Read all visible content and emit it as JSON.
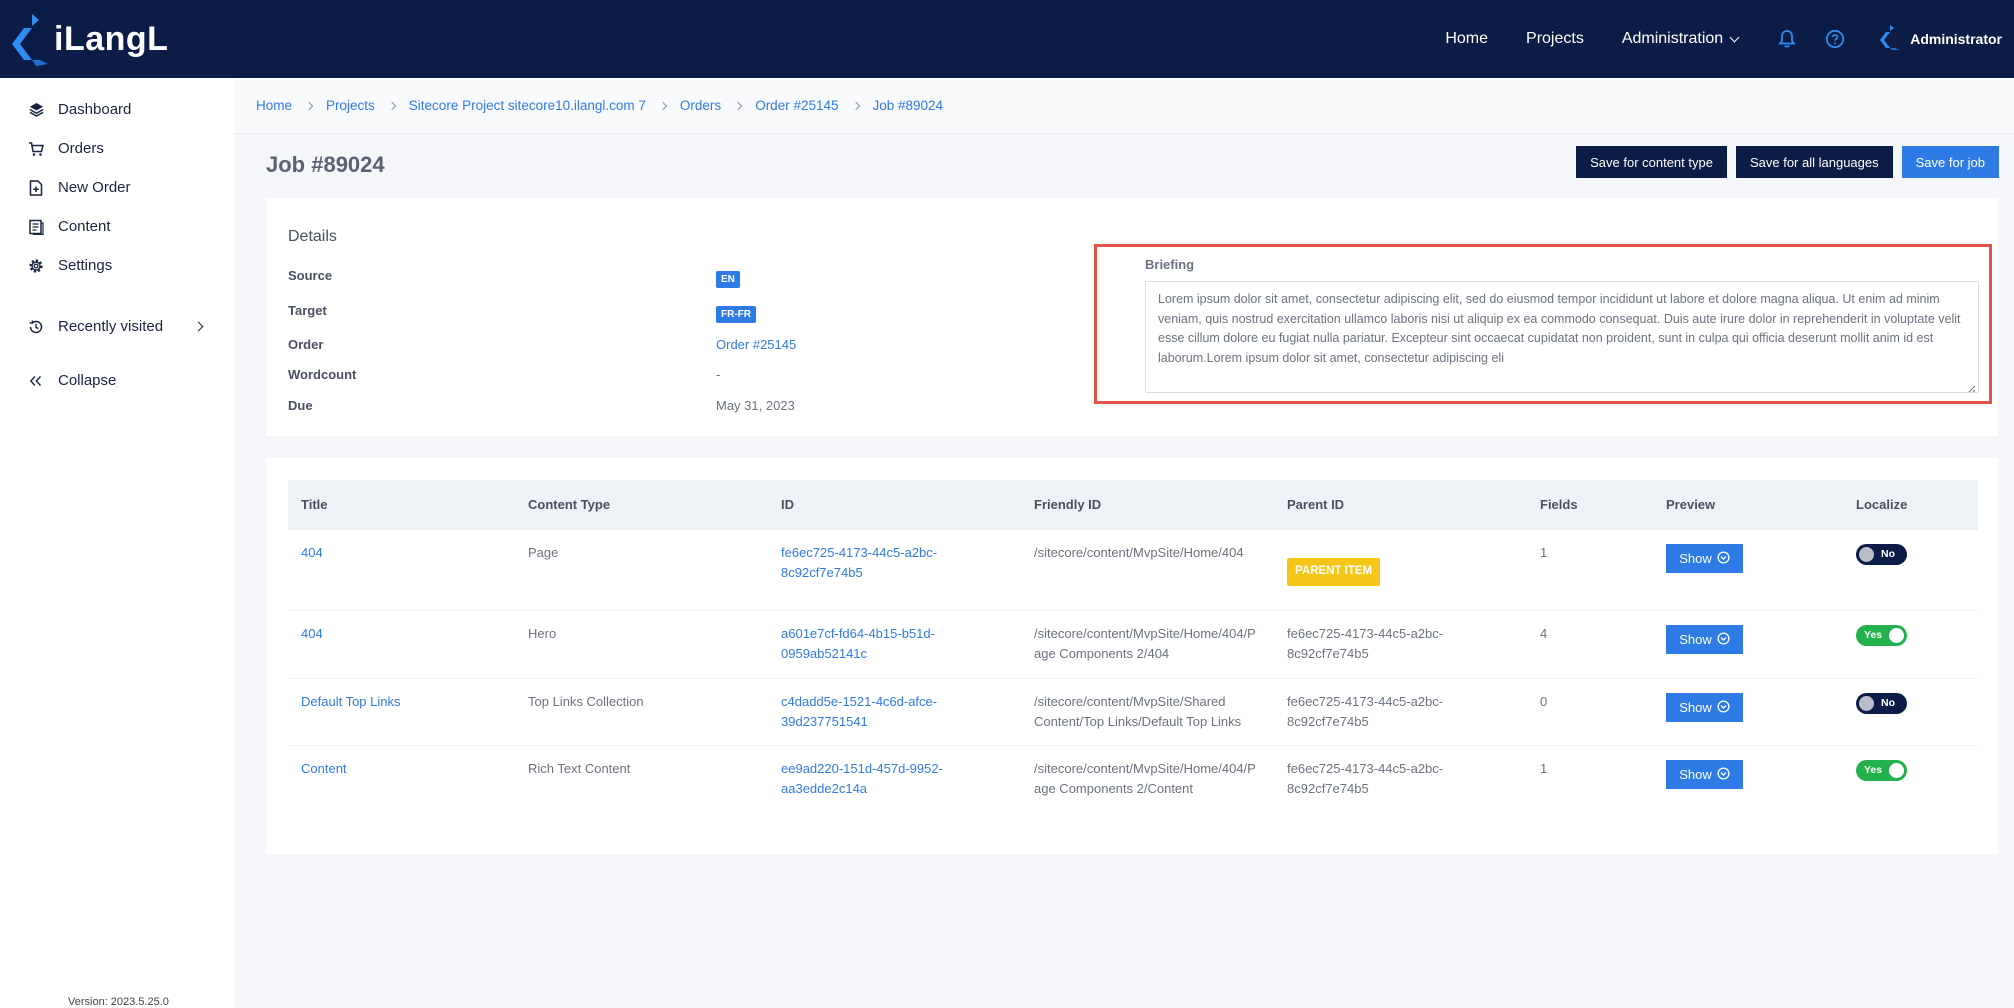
{
  "app": {
    "logo_text": "iLangL"
  },
  "topnav": {
    "home": "Home",
    "projects": "Projects",
    "administration": "Administration",
    "user": "Administrator"
  },
  "sidebar": {
    "items": [
      {
        "label": "Dashboard",
        "icon": "layers-icon"
      },
      {
        "label": "Orders",
        "icon": "cart-icon"
      },
      {
        "label": "New Order",
        "icon": "new-document-icon"
      },
      {
        "label": "Content",
        "icon": "content-icon"
      },
      {
        "label": "Settings",
        "icon": "gear-icon"
      }
    ],
    "recently_visited": "Recently visited",
    "collapse": "Collapse",
    "version": "Version: 2023.5.25.0"
  },
  "breadcrumb": [
    "Home",
    "Projects",
    "Sitecore Project sitecore10.ilangl.com 7",
    "Orders",
    "Order #25145",
    "Job #89024"
  ],
  "page": {
    "title": "Job #89024",
    "actions": {
      "save_content_type": "Save for content type",
      "save_all_languages": "Save for all languages",
      "save_job": "Save for job"
    }
  },
  "details": {
    "title": "Details",
    "source_label": "Source",
    "source_value": "EN",
    "target_label": "Target",
    "target_value": "FR-FR",
    "order_label": "Order",
    "order_value": "Order #25145",
    "wordcount_label": "Wordcount",
    "wordcount_value": "-",
    "due_label": "Due",
    "due_value": "May 31, 2023"
  },
  "briefing": {
    "label": "Briefing",
    "text": "Lorem ipsum dolor sit amet, consectetur adipiscing elit, sed do eiusmod tempor incididunt ut labore et dolore magna aliqua. Ut enim ad minim veniam, quis nostrud exercitation ullamco laboris nisi ut aliquip ex ea commodo consequat. Duis aute irure dolor in reprehenderit in voluptate velit esse cillum dolore eu fugiat nulla pariatur. Excepteur sint occaecat cupidatat non proident, sunt in culpa qui officia deserunt mollit anim id est laborum.Lorem ipsum dolor sit amet, consectetur adipiscing eli"
  },
  "table": {
    "headers": {
      "title": "Title",
      "content_type": "Content Type",
      "id": "ID",
      "friendly_id": "Friendly ID",
      "parent_id": "Parent ID",
      "fields": "Fields",
      "preview": "Preview",
      "localize": "Localize"
    },
    "show_label": "Show",
    "parent_badge": "PARENT ITEM",
    "rows": [
      {
        "title": "404",
        "content_type": "Page",
        "id_line1": "fe6ec725-4173-44c5-a2bc-",
        "id_line2": "8c92cf7e74b5",
        "friendly_line1": "/sitecore/content/MvpSite/Home/404",
        "friendly_line2": "",
        "parent_line1": "",
        "parent_line2": "",
        "fields": "1",
        "localize": "No"
      },
      {
        "title": "404",
        "content_type": "Hero",
        "id_line1": "a601e7cf-fd64-4b15-b51d-",
        "id_line2": "0959ab52141c",
        "friendly_line1": "/sitecore/content/MvpSite/Home/404/P",
        "friendly_line2": "age Components 2/404",
        "parent_line1": "fe6ec725-4173-44c5-a2bc-",
        "parent_line2": "8c92cf7e74b5",
        "fields": "4",
        "localize": "Yes"
      },
      {
        "title": "Default Top Links",
        "content_type": "Top Links Collection",
        "id_line1": "c4dadd5e-1521-4c6d-afce-",
        "id_line2": "39d237751541",
        "friendly_line1": "/sitecore/content/MvpSite/Shared",
        "friendly_line2": "Content/Top Links/Default Top Links",
        "parent_line1": "fe6ec725-4173-44c5-a2bc-",
        "parent_line2": "8c92cf7e74b5",
        "fields": "0",
        "localize": "No"
      },
      {
        "title": "Content",
        "content_type": "Rich Text Content",
        "id_line1": "ee9ad220-151d-457d-9952-",
        "id_line2": "aa3edde2c14a",
        "friendly_line1": "/sitecore/content/MvpSite/Home/404/P",
        "friendly_line2": "age Components 2/Content",
        "parent_line1": "fe6ec725-4173-44c5-a2bc-",
        "parent_line2": "8c92cf7e74b5",
        "fields": "1",
        "localize": "Yes"
      }
    ]
  },
  "colors": {
    "navy": "#0b1c47",
    "accent_blue": "#2f7be5",
    "toggle_yes": "#22b14c",
    "badge_yellow": "#f5c518",
    "highlight_red": "#e05545"
  }
}
